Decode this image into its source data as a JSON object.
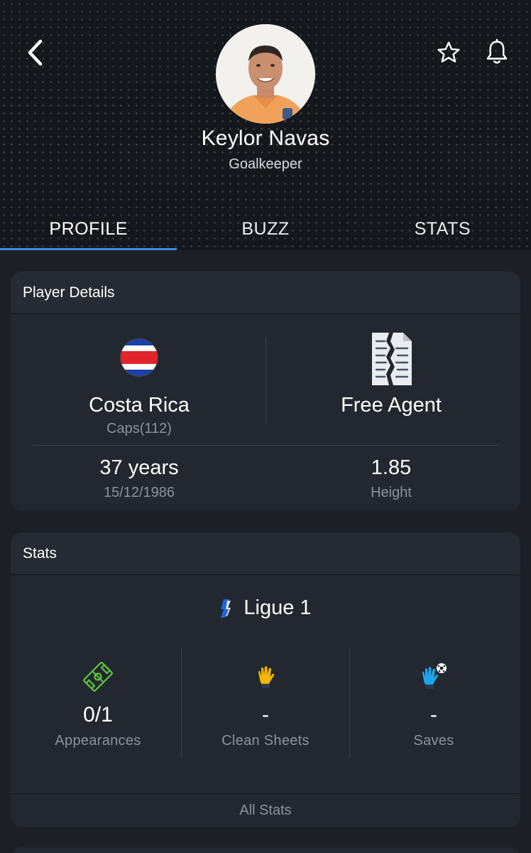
{
  "header": {
    "player_name": "Keylor Navas",
    "position": "Goalkeeper",
    "tabs": [
      {
        "label": "PROFILE",
        "active": true
      },
      {
        "label": "BUZZ",
        "active": false
      },
      {
        "label": "STATS",
        "active": false
      }
    ],
    "icons": {
      "back": "chevron-left-icon",
      "favorite": "star-icon",
      "notify": "bell-icon"
    }
  },
  "player_details": {
    "title": "Player Details",
    "country": "Costa Rica",
    "caps": "Caps(112)",
    "contract_status": "Free Agent",
    "age": "37 years",
    "birth_date": "15/12/1986",
    "height_value": "1.85",
    "height_label": "Height"
  },
  "stats": {
    "title": "Stats",
    "league": "Ligue 1",
    "items": [
      {
        "value": "0/1",
        "label": "Appearances",
        "icon": "pitch-icon"
      },
      {
        "value": "-",
        "label": "Clean Sheets",
        "icon": "glove-icon"
      },
      {
        "value": "-",
        "label": "Saves",
        "icon": "glove-ball-icon"
      }
    ],
    "all_stats_label": "All Stats"
  },
  "colors": {
    "accent": "#3d8fe0",
    "background": "#1c2026",
    "card": "#232830",
    "muted_text": "#8a929c"
  }
}
